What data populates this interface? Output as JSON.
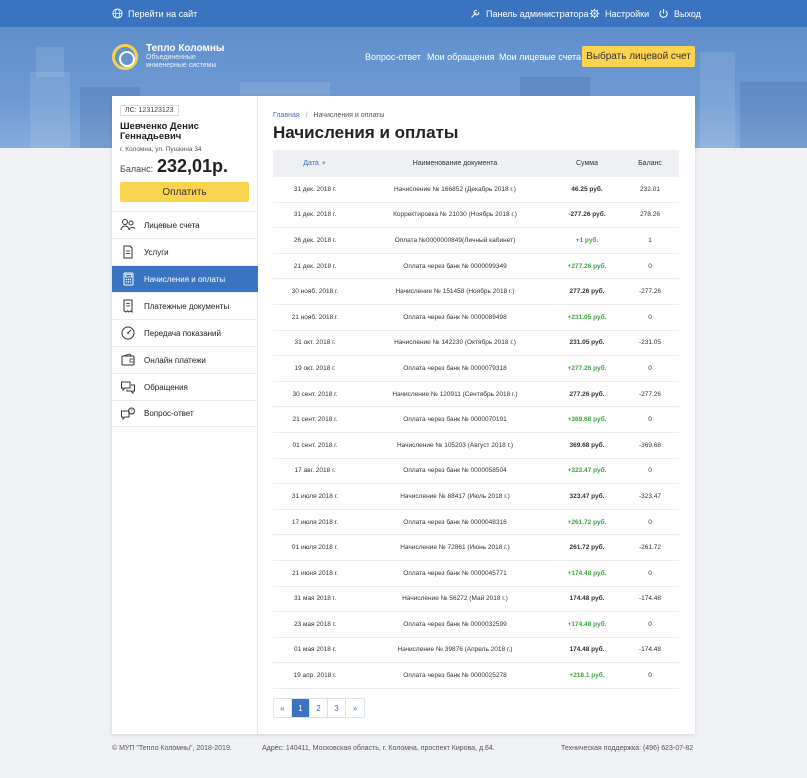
{
  "topbar": {
    "site_link": "Перейти на сайт",
    "admin": "Панель администратора",
    "settings": "Настройки",
    "logout": "Выход"
  },
  "logo": {
    "title": "Тепло Коломны",
    "subtitle": "Объединенные инженерные системы"
  },
  "nav": {
    "faq": "Вопрос-ответ",
    "appeals": "Мои обращения",
    "accounts": "Мои лицевые счета",
    "select_account": "Выбрать лицевой счет"
  },
  "account": {
    "ls": "ЛС: 123123123",
    "name": "Шевченко Денис Геннадьевич",
    "address": "г. Коломна, ул. Пушкина 34",
    "balance_label": "Баланс:",
    "balance": "232,01р.",
    "pay_button": "Оплатить"
  },
  "menu": [
    {
      "label": "Лицевые счета",
      "icon": "people-icon"
    },
    {
      "label": "Услуги",
      "icon": "document-icon"
    },
    {
      "label": "Начисления и оплаты",
      "icon": "calculator-icon"
    },
    {
      "label": "Платежные документы",
      "icon": "receipt-icon"
    },
    {
      "label": "Передача показаний",
      "icon": "gauge-icon"
    },
    {
      "label": "Онлайн платежи",
      "icon": "wallet-icon"
    },
    {
      "label": "Обращения",
      "icon": "chat-icon"
    },
    {
      "label": "Вопрос-ответ",
      "icon": "question-chat-icon"
    }
  ],
  "breadcrumb": {
    "home": "Главная",
    "current": "Начисления и оплаты"
  },
  "page_title": "Начисления и оплаты",
  "table": {
    "headers": {
      "date": "Дата",
      "name": "Наименование документа",
      "sum": "Сумма",
      "balance": "Баланс"
    },
    "rows": [
      {
        "date": "31 дек. 2018 г.",
        "name": "Начисление № 166852 (Декабрь 2018 г.)",
        "sum": "46.25 руб.",
        "balance": "232.01"
      },
      {
        "date": "31 дек. 2018 г.",
        "name": "Корректировка № 21030 (Ноябрь 2018 г.)",
        "sum": "-277.26 руб.",
        "balance": "278.26"
      },
      {
        "date": "26 дек. 2018 г.",
        "name": "Оплата №0000000849(Личный кабинет)",
        "sum": "+1 руб.",
        "balance": "1"
      },
      {
        "date": "21 дек. 2018 г.",
        "name": "Оплата через банк № 0000099349",
        "sum": "+277.26 руб.",
        "balance": "0"
      },
      {
        "date": "30 нояб. 2018 г.",
        "name": "Начисление № 151458 (Ноябрь 2018 г.)",
        "sum": "277.26 руб.",
        "balance": "-277.26"
      },
      {
        "date": "21 нояб. 2018 г.",
        "name": "Оплата через банк № 0000089498",
        "sum": "+231.05 руб.",
        "balance": "0"
      },
      {
        "date": "31 окт. 2018 г.",
        "name": "Начисление № 142230 (Октябрь 2018 г.)",
        "sum": "231.05 руб.",
        "balance": "-231.05"
      },
      {
        "date": "19 окт. 2018 г.",
        "name": "Оплата через банк № 0000079318",
        "sum": "+277.26 руб.",
        "balance": "0"
      },
      {
        "date": "30 сент. 2018 г.",
        "name": "Начисление № 120911 (Сентябрь 2018 г.)",
        "sum": "277.26 руб.",
        "balance": "-277.26"
      },
      {
        "date": "21 сент. 2018 г.",
        "name": "Оплата через банк № 0000070191",
        "sum": "+369.68 руб.",
        "balance": "0"
      },
      {
        "date": "01 сент. 2018 г.",
        "name": "Начисление № 105203 (Август 2018 г.)",
        "sum": "369.68 руб.",
        "balance": "-369.68"
      },
      {
        "date": "17 авг. 2018 г.",
        "name": "Оплата через банк № 0000058504",
        "sum": "+323.47 руб.",
        "balance": "0"
      },
      {
        "date": "31 июля 2018 г.",
        "name": "Начисление № 88417 (Июль 2018 г.)",
        "sum": "323.47 руб.",
        "balance": "-323.47"
      },
      {
        "date": "17 июля 2018 г.",
        "name": "Оплата через банк № 0000048316",
        "sum": "+261.72 руб.",
        "balance": "0"
      },
      {
        "date": "01 июля 2018 г.",
        "name": "Начисление № 72861 (Июнь 2018 г.)",
        "sum": "261.72 руб.",
        "balance": "-261.72"
      },
      {
        "date": "21 июня 2018 г.",
        "name": "Оплата через банк № 0000045771",
        "sum": "+174.48 руб.",
        "balance": "0"
      },
      {
        "date": "31 мая 2018 г.",
        "name": "Начисление № 56272 (Май 2018 г.)",
        "sum": "174.48 руб.",
        "balance": "-174.48"
      },
      {
        "date": "23 мая 2018 г.",
        "name": "Оплата через банк № 0000032599",
        "sum": "+174.48 руб.",
        "balance": "0"
      },
      {
        "date": "01 мая 2018 г.",
        "name": "Начисление № 39876 (Апрель 2018 г.)",
        "sum": "174.48 руб.",
        "balance": "-174.48"
      },
      {
        "date": "19 апр. 2018 г.",
        "name": "Оплата через банк № 0000025278",
        "sum": "+218.1 руб.",
        "balance": "0"
      }
    ]
  },
  "pagination": {
    "prev": "«",
    "pages": [
      "1",
      "2",
      "3"
    ],
    "current": "1",
    "next": "»"
  },
  "footer": {
    "copyright": "© МУП \"Тепло Коломны\", 2018-2019.",
    "address": "Адрес: 140411, Московская область, г. Коломна, проспект Кирова, д.64.",
    "support": "Техническая поддержка: (496) 623-07-82"
  },
  "colors": {
    "primary": "#3a73bf",
    "accent": "#fbd34e",
    "positive": "#3aa63a"
  }
}
